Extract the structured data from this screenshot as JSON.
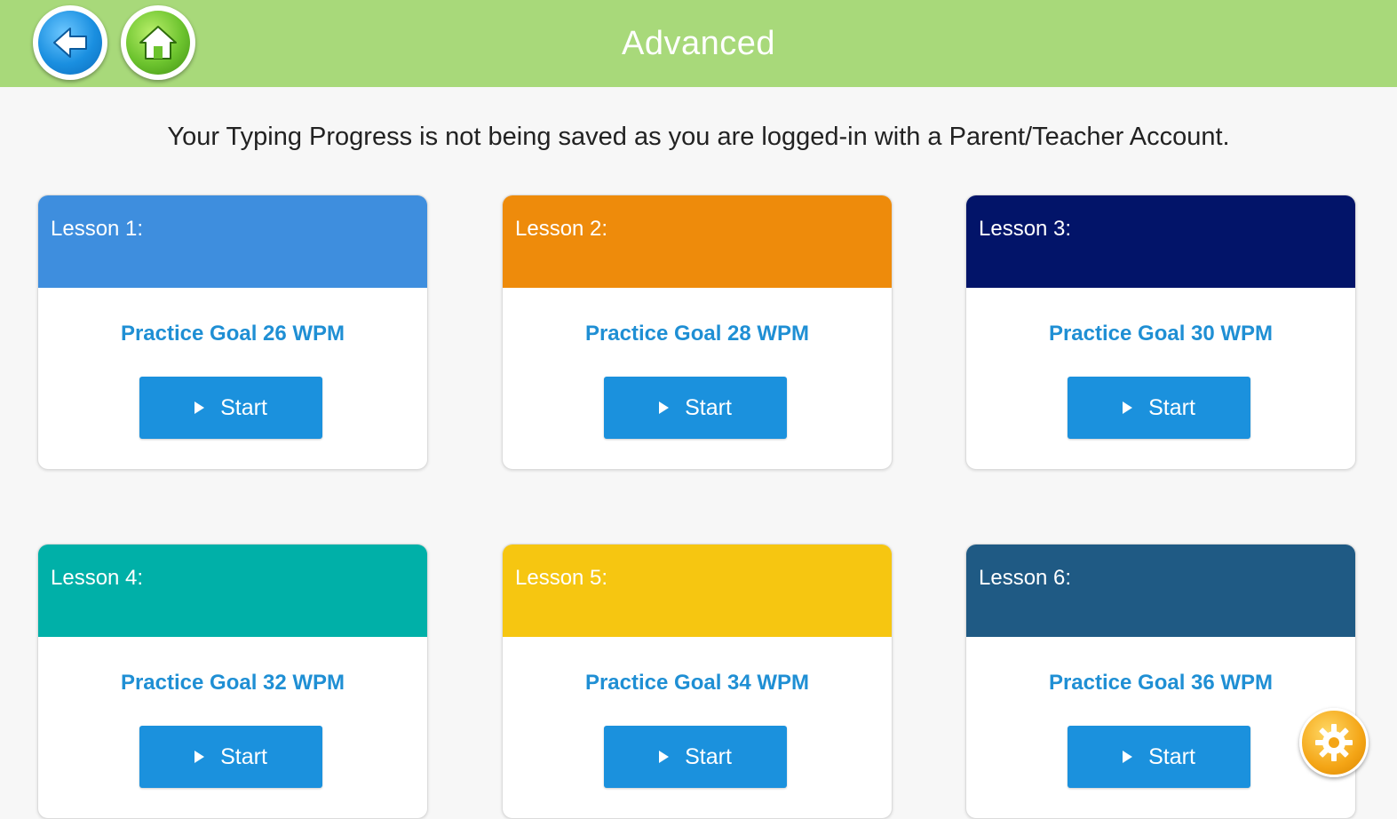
{
  "header": {
    "title": "Advanced",
    "back_icon": "back-arrow-icon",
    "home_icon": "home-icon",
    "background_color": "#a8d97a"
  },
  "notice": "Your Typing Progress is not being saved as you are logged-in with a Parent/Teacher Account.",
  "lessons": [
    {
      "label": "Lesson 1:",
      "goal": "Practice Goal 26 WPM",
      "start": "Start",
      "color": "#3e8ede"
    },
    {
      "label": "Lesson 2:",
      "goal": "Practice Goal 28 WPM",
      "start": "Start",
      "color": "#ee8b0b"
    },
    {
      "label": "Lesson 3:",
      "goal": "Practice Goal 30 WPM",
      "start": "Start",
      "color": "#021469"
    },
    {
      "label": "Lesson 4:",
      "goal": "Practice Goal 32 WPM",
      "start": "Start",
      "color": "#00b0a8"
    },
    {
      "label": "Lesson 5:",
      "goal": "Practice Goal 34 WPM",
      "start": "Start",
      "color": "#f6c611"
    },
    {
      "label": "Lesson 6:",
      "goal": "Practice Goal 36 WPM",
      "start": "Start",
      "color": "#1f5a84"
    }
  ],
  "settings_icon": "gear-icon"
}
